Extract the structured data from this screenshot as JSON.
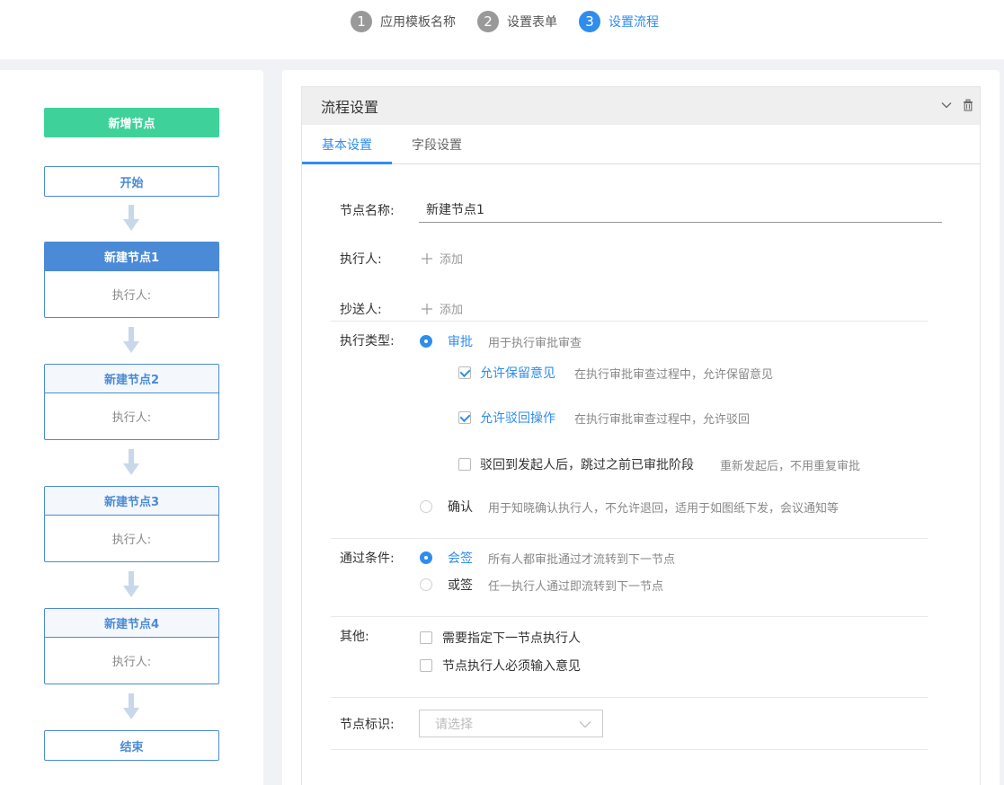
{
  "steps": [
    {
      "num": "1",
      "label": "应用模板名称"
    },
    {
      "num": "2",
      "label": "设置表单"
    },
    {
      "num": "3",
      "label": "设置流程"
    }
  ],
  "flow": {
    "add_node_label": "新增节点",
    "start_label": "开始",
    "end_label": "结束",
    "nodes": [
      {
        "title": "新建节点1",
        "executor": "执行人:"
      },
      {
        "title": "新建节点2",
        "executor": "执行人:"
      },
      {
        "title": "新建节点3",
        "executor": "执行人:"
      },
      {
        "title": "新建节点4",
        "executor": "执行人:"
      }
    ]
  },
  "panel": {
    "title": "流程设置",
    "tabs": [
      "基本设置",
      "字段设置"
    ]
  },
  "form": {
    "node_name_label": "节点名称:",
    "node_name_value": "新建节点1",
    "executor_label": "执行人:",
    "cc_label": "抄送人:",
    "add_label": "添加",
    "exec_type_label": "执行类型:",
    "approve_label": "审批",
    "approve_desc": "用于执行审批审查",
    "allow_opinion_label": "允许保留意见",
    "allow_opinion_desc": "在执行审批审查过程中，允许保留意见",
    "allow_reject_label": "允许驳回操作",
    "allow_reject_desc": "在执行审批审查过程中，允许驳回",
    "skip_label": "驳回到发起人后，跳过之前已审批阶段",
    "skip_desc": "重新发起后，不用重复审批",
    "confirm_label": "确认",
    "confirm_desc": "用于知晓确认执行人，不允许退回，适用于如图纸下发，会议通知等",
    "pass_cond_label": "通过条件:",
    "countersign_label": "会签",
    "countersign_desc": "所有人都审批通过才流转到下一节点",
    "orsign_label": "或签",
    "orsign_desc": "任一执行人通过即流转到下一节点",
    "other_label": "其他:",
    "other_opt1": "需要指定下一节点执行人",
    "other_opt2": "节点执行人必须输入意见",
    "node_mark_label": "节点标识:",
    "node_mark_placeholder": "请选择"
  }
}
